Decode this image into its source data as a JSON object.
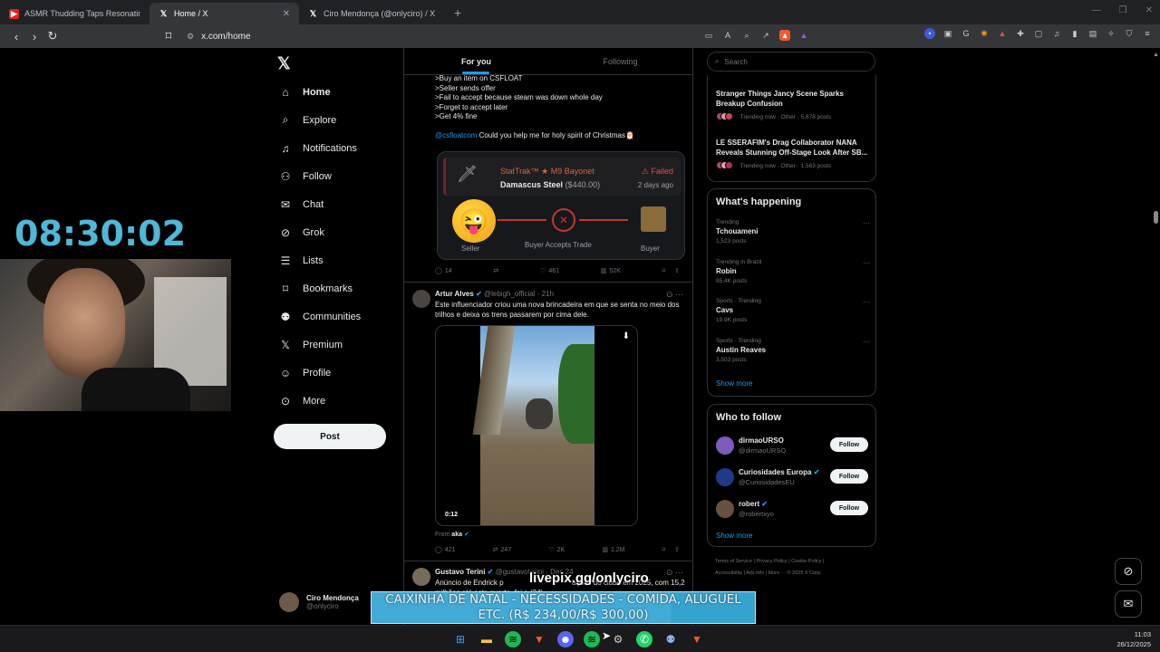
{
  "browser": {
    "tabs": [
      {
        "label": "ASMR Thudding Taps Resonating in",
        "icon": "youtube-icon",
        "active": false
      },
      {
        "label": "Home / X",
        "icon": "x-icon",
        "active": true
      },
      {
        "label": "Ciro Mendonça (@onlyciro) / X",
        "icon": "x-icon",
        "active": false
      }
    ],
    "url": "x.com/home"
  },
  "stream": {
    "clock": "08:30:02",
    "overlay_url": "livepix.gg/onlyciro",
    "banner_line1": "CAIXINHA DE NATAL - NECESSIDADES - COMIDA, ALUGUEL",
    "banner_line2": "ETC. (R$ 234,00/R$ 300,00)",
    "goal_progress": 0.78
  },
  "sidebar": {
    "items": [
      {
        "label": "Home",
        "icon": "home-icon"
      },
      {
        "label": "Explore",
        "icon": "search-icon"
      },
      {
        "label": "Notifications",
        "icon": "bell-icon"
      },
      {
        "label": "Follow",
        "icon": "follow-icon"
      },
      {
        "label": "Chat",
        "icon": "mail-icon"
      },
      {
        "label": "Grok",
        "icon": "grok-icon"
      },
      {
        "label": "Lists",
        "icon": "list-icon"
      },
      {
        "label": "Bookmarks",
        "icon": "bookmark-icon"
      },
      {
        "label": "Communities",
        "icon": "communities-icon"
      },
      {
        "label": "Premium",
        "icon": "x-icon"
      },
      {
        "label": "Profile",
        "icon": "profile-icon"
      },
      {
        "label": "More",
        "icon": "more-icon"
      }
    ],
    "post_label": "Post",
    "account_name": "Ciro Mendonça",
    "account_handle": "@onlyciro"
  },
  "feed": {
    "tab_for_you": "For you",
    "tab_following": "Following",
    "tweet1": {
      "lines": [
        ">Buy an item on CSFLOAT",
        ">Seller sends offer",
        ">Fail to accept because steam was down whole day",
        ">Forget to accept later",
        ">Get 4% fine"
      ],
      "mention": "@csfloatcom",
      "text_after": " Could you help me for holy spirit of Christmas",
      "card": {
        "stattrak": "StatTrak™ ★ M9 Bayonet",
        "skin": "Damascus Steel",
        "price": "($440.00)",
        "status": "Failed",
        "time": "2 days ago",
        "seller": "Seller",
        "middle": "Buyer Accepts Trade",
        "buyer": "Buyer"
      },
      "replies": "14",
      "likes": "461",
      "views": "52K"
    },
    "tweet2": {
      "name": "Artur Alves",
      "handle": "@lebigh_official · 21h",
      "text": "Este influenciador criou uma nova brincadeira em que se senta no meio dos trilhos e deixa os trens passarem por cima dele.",
      "duration": "0:12",
      "from_label": "From",
      "from_name": "aka",
      "replies": "421",
      "reposts": "247",
      "likes": "2K",
      "views": "1.2M"
    },
    "tweet3": {
      "name": "Gustavo Terini",
      "handle": "@gustavoterini · Dec 24",
      "text": "Anúncio de Endrick p                                  ações do clube em 2025, com 15,2 milhões até este quarto, foi a (24)"
    }
  },
  "right": {
    "search_placeholder": "Search",
    "news": [
      {
        "title": "Stranger Things Jancy Scene Sparks Breakup Confusion",
        "meta": "Trending now · Other · 5,678 posts"
      },
      {
        "title": "LE SSERAFIM's Drag Collaborator NANA Reveals Stunning Off-Stage Look After SB...",
        "meta": "Trending now · Other · 1,563 posts"
      }
    ],
    "happening_title": "What's happening",
    "trends": [
      {
        "category": "Trending",
        "name": "Tchouameni",
        "posts": "1,523 posts"
      },
      {
        "category": "Trending in Brazil",
        "name": "Robin",
        "posts": "85.4K posts"
      },
      {
        "category": "Sports · Trending",
        "name": "Cavs",
        "posts": "19.9K posts"
      },
      {
        "category": "Sports · Trending",
        "name": "Austin Reaves",
        "posts": "3,503 posts"
      }
    ],
    "show_more": "Show more",
    "who_title": "Who to follow",
    "who": [
      {
        "name": "dirmaoURSO",
        "handle": "@dirmaoURSO",
        "follow": "Follow",
        "verified": false
      },
      {
        "name": "Curiosidades Europa",
        "handle": "@CuriosidadesEU",
        "follow": "Follow",
        "verified": true
      },
      {
        "name": "robert",
        "handle": "@robertxyo",
        "follow": "Follow",
        "verified": true
      }
    ],
    "show_more2": "Show more",
    "footer1": "Terms of Service  |  Privacy Policy  |  Cookie Policy  |",
    "footer2": "Accessibility  |  Ads info  |  More ···  © 2025 X Corp."
  },
  "taskbar": {
    "time": "11:03",
    "date": "26/12/2025"
  }
}
